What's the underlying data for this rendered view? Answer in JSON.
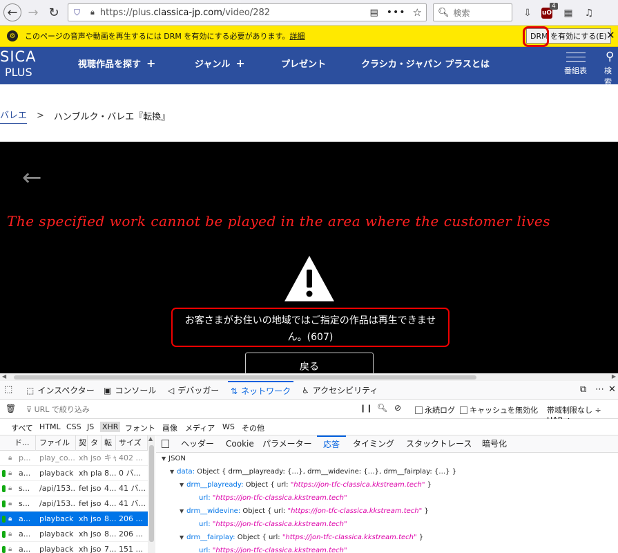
{
  "browser": {
    "url_prefix": "https://plus.",
    "url_domain": "classica-jp.com",
    "url_path": "/video/282",
    "search_placeholder": "検索",
    "ublock_count": "4",
    "dots": "•••"
  },
  "drm_bar": {
    "message": "このページの音声や動画を再生するには DRM を有効にする必要があります。",
    "link": "詳細",
    "button": "DRM を有効にする(E)",
    "close": "✕"
  },
  "site": {
    "logo_top": "SICA",
    "logo_bottom": "PLUS",
    "nav": [
      {
        "label": "視聴作品を探す",
        "plus": "+"
      },
      {
        "label": "ジャンル",
        "plus": "+"
      },
      {
        "label": "プレゼント"
      },
      {
        "label": "クラシカ・ジャパン プラスとは"
      }
    ],
    "menu_label": "番組表",
    "search_label": "検索"
  },
  "breadcrumb": {
    "parent": "バレエ",
    "sep": ">",
    "current": "ハンブルク・バレエ『転換』"
  },
  "player": {
    "warning": "The specified work cannot be played in the area where the customer lives",
    "error_line1": "お客さまがお住いの地域ではご指定の作品は再生できませ",
    "error_line2": "ん。(607)",
    "return_button": "戻る"
  },
  "devtools": {
    "tabs": [
      {
        "label": "インスペクター",
        "icon": "⬚"
      },
      {
        "label": "コンソール",
        "icon": "▣"
      },
      {
        "label": "デバッガー",
        "icon": "◁"
      },
      {
        "label": "ネットワーク",
        "icon": "⇅",
        "active": true
      },
      {
        "label": "アクセシビリティ",
        "icon": "♿"
      }
    ],
    "filter_placeholder": "URL で絞り込み",
    "persist_log": "永続ログ",
    "disable_cache": "キャッシュを無効化",
    "throttle": "帯域制限なし ÷ HAR ÷",
    "type_filters": [
      "すべて",
      "HTML",
      "CSS",
      "JS",
      "XHR",
      "フォント",
      "画像",
      "メディア",
      "WS",
      "その他"
    ],
    "columns": [
      "ド...",
      "ファイル",
      "契",
      "タ",
      "転",
      "サイズ"
    ],
    "requests": [
      {
        "d": "p...",
        "file": "play_co...",
        "c": "xh",
        "t": "jso",
        "tr": "キャ",
        "size": "402 ...",
        "dim": true
      },
      {
        "d": "a...",
        "file": "playback",
        "c": "xh",
        "t": "pla",
        "tr": "8...",
        "size": "0 バ..."
      },
      {
        "d": "s...",
        "file": "/api/153...",
        "c": "fet",
        "t": "jso",
        "tr": "4...",
        "size": "41 バ..."
      },
      {
        "d": "s...",
        "file": "/api/153...",
        "c": "fet",
        "t": "jso",
        "tr": "4...",
        "size": "41 バ..."
      },
      {
        "d": "a...",
        "file": "playback",
        "c": "xh",
        "t": "jso",
        "tr": "8...",
        "size": "206 ...",
        "selected": true
      },
      {
        "d": "a...",
        "file": "playback",
        "c": "xh",
        "t": "jso",
        "tr": "8...",
        "size": "206 ..."
      },
      {
        "d": "a...",
        "file": "playback",
        "c": "xh",
        "t": "jso",
        "tr": "7...",
        "size": "151 ..."
      }
    ],
    "detail_tabs": [
      "ヘッダー",
      "Cookie",
      "パラメーター",
      "応答",
      "タイミング",
      "スタックトレース",
      "暗号化"
    ],
    "json": {
      "root_label": "JSON",
      "data_key": "data:",
      "data_summary": "Object { drm__playready: {…}, drm__widevine: {…}, drm__fairplay: {…} }",
      "pr_key": "drm__playready:",
      "pr_summary": "Object { url: ",
      "wv_key": "drm__widevine:",
      "wv_summary": "Object { url: ",
      "fp_key": "drm__fairplay:",
      "fp_summary": "Object { url: ",
      "url_key": "url:",
      "url_value": "\"https://jon-tfc-classica.kkstream.tech\"",
      "close_brace": " }"
    }
  },
  "colors": {
    "site_blue": "#2c4f9e",
    "drm_yellow": "#ffe900",
    "warn_red": "#ff2020",
    "devtools_accent": "#0060df"
  }
}
